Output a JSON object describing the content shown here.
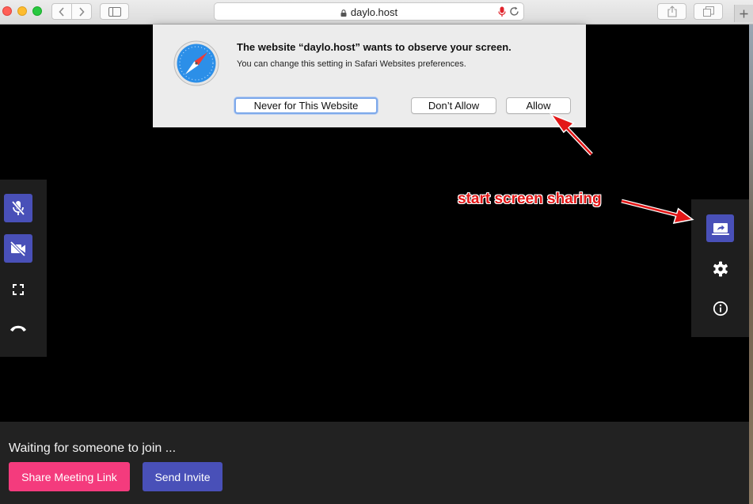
{
  "browser": {
    "url": "daylo.host",
    "icons": [
      "back-icon",
      "forward-icon",
      "sidebar-icon",
      "lock-icon",
      "microphone-icon",
      "reload-icon",
      "share-icon",
      "tabs-icon",
      "plus-icon"
    ]
  },
  "permission_dialog": {
    "title": "The website “daylo.host” wants to observe your screen.",
    "message": "You can change this setting in Safari Websites preferences.",
    "buttons": {
      "never": "Never for This Website",
      "deny": "Don’t Allow",
      "allow": "Allow"
    },
    "icon": "safari-compass-icon"
  },
  "annotation": {
    "text": "start screen sharing",
    "color": "#e31717"
  },
  "left_controls": {
    "icons": [
      "microphone-off-icon",
      "video-off-icon",
      "fullscreen-icon",
      "hang-up-icon"
    ]
  },
  "right_controls": {
    "icons": [
      "screen-share-icon",
      "settings-icon",
      "info-icon"
    ]
  },
  "meeting": {
    "status": "Waiting for someone to join ...",
    "share_link_label": "Share Meeting Link",
    "send_invite_label": "Send Invite"
  },
  "colors": {
    "accent": "#4950b8",
    "pink": "#f43b7d",
    "panel": "#1e1e1e"
  }
}
